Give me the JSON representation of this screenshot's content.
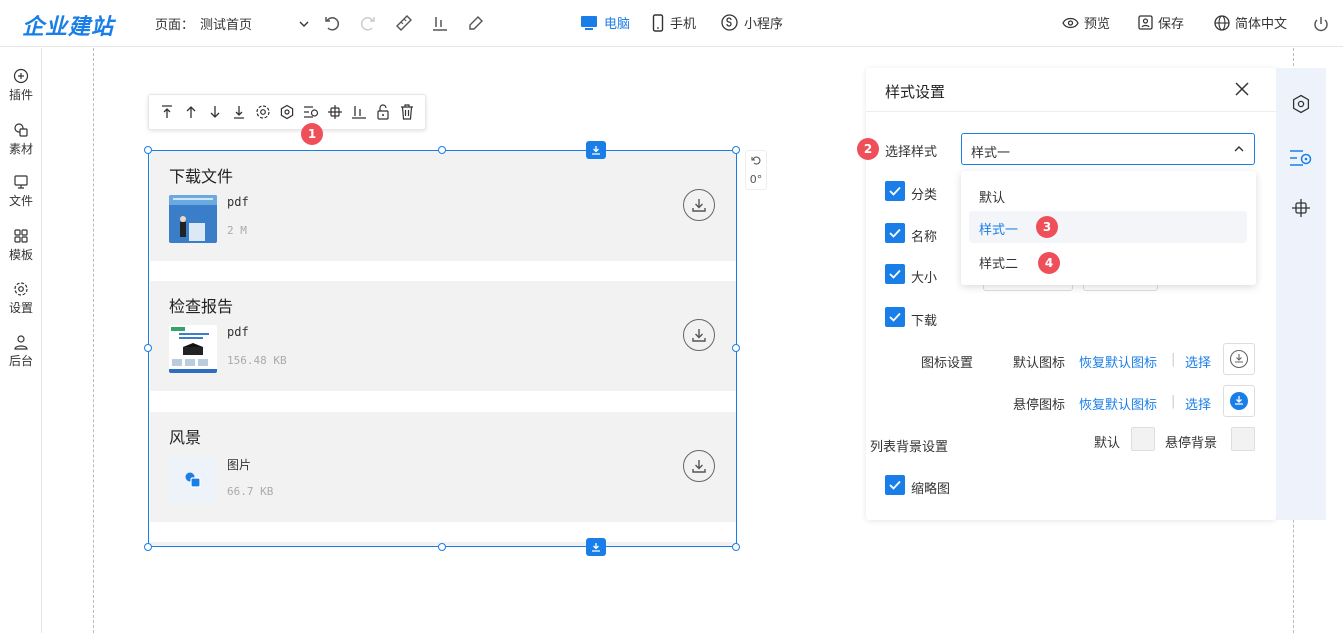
{
  "header": {
    "logo": "企业建站",
    "page_label": "页面：",
    "page_name": "测试首页",
    "devices": [
      {
        "label": "电脑",
        "icon": "monitor-icon",
        "active": true
      },
      {
        "label": "手机",
        "icon": "phone-icon",
        "active": false
      },
      {
        "label": "小程序",
        "icon": "miniprogram-icon",
        "active": false
      }
    ],
    "preview": "预览",
    "save": "保存",
    "language": "简体中文"
  },
  "sidebar": {
    "items": [
      {
        "label": "插件",
        "icon": "plus-circle-icon"
      },
      {
        "label": "素材",
        "icon": "material-icon"
      },
      {
        "label": "文件",
        "icon": "folder-icon"
      },
      {
        "label": "模板",
        "icon": "grid-icon"
      },
      {
        "label": "设置",
        "icon": "gear-icon"
      },
      {
        "label": "后台",
        "icon": "user-icon"
      }
    ]
  },
  "component_toolbar": {
    "badge": "1",
    "icons": [
      "move-top-icon",
      "move-up-icon",
      "move-down-icon",
      "move-bottom-icon",
      "settings-icon",
      "style-icon",
      "list-style-icon",
      "align-icon",
      "chart-icon",
      "unlock-icon",
      "delete-icon"
    ]
  },
  "widget": {
    "rotate_value": "0°",
    "items": [
      {
        "title": "下载文件",
        "type": "pdf",
        "size": "2 M",
        "thumb": "poster"
      },
      {
        "title": "检查报告",
        "type": "pdf",
        "size": "156.48 KB",
        "thumb": "report"
      },
      {
        "title": "风景",
        "type": "图片",
        "size": "66.7 KB",
        "thumb": "image"
      }
    ]
  },
  "style_panel": {
    "title": "样式设置",
    "select_label": "选择样式",
    "select_value": "样式一",
    "select_badge": "2",
    "options": [
      {
        "label": "默认",
        "selected": false,
        "badge": ""
      },
      {
        "label": "样式一",
        "selected": true,
        "badge": "3"
      },
      {
        "label": "样式二",
        "selected": false,
        "badge": "4"
      }
    ],
    "checkboxes": [
      {
        "label": "分类",
        "checked": true
      },
      {
        "label": "名称",
        "checked": true
      },
      {
        "label": "大小",
        "checked": true
      },
      {
        "label": "下载",
        "checked": true
      },
      {
        "label": "缩略图",
        "checked": true
      }
    ],
    "icon_settings_label": "图标设置",
    "default_icon_label": "默认图标",
    "hover_icon_label": "悬停图标",
    "restore_default": "恢复默认图标",
    "choose": "选择",
    "separator": "|",
    "list_bg_label": "列表背景设置",
    "bg_default": "默认",
    "bg_hover": "悬停背景"
  },
  "colors": {
    "accent": "#1a7ee8",
    "badge": "#ef4f59",
    "row_bg": "#f2f2f2"
  }
}
